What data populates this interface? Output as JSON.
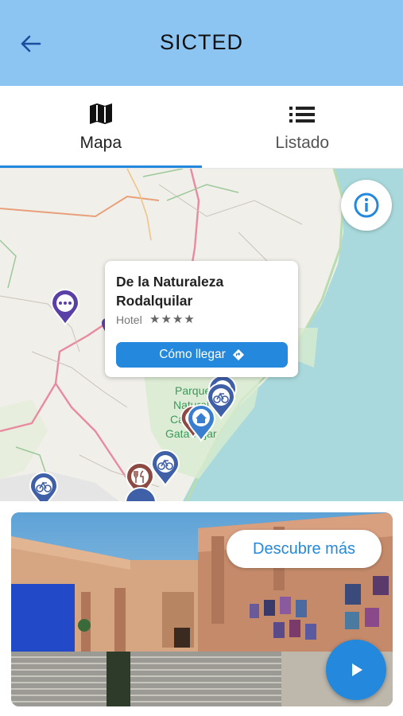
{
  "header": {
    "title": "SICTED",
    "back_icon": "arrow-left-icon"
  },
  "tabs": [
    {
      "label": "Mapa",
      "icon": "map-icon",
      "active": true
    },
    {
      "label": "Listado",
      "icon": "list-icon",
      "active": false
    }
  ],
  "map": {
    "info_icon": "info-icon",
    "labels": [
      "Parque",
      "Natural",
      "Cabo de",
      "Gata-Níjar"
    ],
    "popup": {
      "name": "De la Naturaleza Rodalquilar",
      "category": "Hotel",
      "stars": "★★★★",
      "rating": 4,
      "directions_label": "Cómo llegar",
      "directions_icon": "directions-icon"
    },
    "pins": [
      {
        "type": "more",
        "icon": "more-icon",
        "color": "#5a3fa6"
      },
      {
        "type": "cycling",
        "icon": "bicycle-icon",
        "color": "#3f5fa6"
      },
      {
        "type": "home",
        "icon": "home-icon",
        "color": "#3a7fcf"
      },
      {
        "type": "restaurant",
        "icon": "restaurant-icon",
        "color": "#8d4a42"
      }
    ]
  },
  "promo": {
    "discover_label": "Descubre más",
    "play_icon": "play-icon"
  },
  "colors": {
    "header_bg": "#8cc4f2",
    "accent": "#2489dc",
    "sea": "#a9d9dc"
  }
}
